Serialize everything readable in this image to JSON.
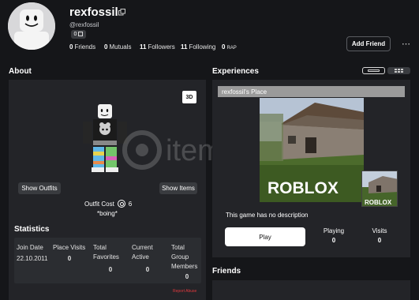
{
  "profile": {
    "username": "rexfossil",
    "handle": "@rexfossil",
    "robux_count": "0",
    "stats": [
      {
        "value": "0",
        "label": "Friends"
      },
      {
        "value": "0",
        "label": "Mutuals"
      },
      {
        "value": "11",
        "label": "Followers"
      },
      {
        "value": "11",
        "label": "Following"
      },
      {
        "value": "0",
        "label": "RAP"
      }
    ],
    "add_friend_label": "Add Friend",
    "more_icon": "⋯"
  },
  "about": {
    "heading": "About",
    "view_3d_label": "3D",
    "show_outfits_label": "Show Outfits",
    "show_items_label": "Show Items",
    "outfit_cost_label": "Outfit Cost",
    "outfit_cost_value": "6",
    "outfit_name": "*boing*"
  },
  "statistics": {
    "heading": "Statistics",
    "columns": [
      {
        "label": "Join Date",
        "value": "22.10.2011"
      },
      {
        "label": "Place Visits",
        "value": "0"
      },
      {
        "label": "Total Favorites",
        "value": "0"
      },
      {
        "label": "Current Active",
        "value": "0"
      },
      {
        "label": "Total Group Members",
        "value": "0"
      }
    ],
    "report_abuse_label": "Report Abuse"
  },
  "experiences": {
    "heading": "Experiences",
    "place_title": "rexfossil's Place",
    "thumbnail_logo": "ROBLOX",
    "description": "This game has no description",
    "play_label": "Play",
    "playing_label": "Playing",
    "playing_value": "0",
    "visits_label": "Visits",
    "visits_value": "0"
  },
  "friends": {
    "heading": "Friends"
  },
  "watermark": "itemsatis",
  "colors": {
    "background": "#151619",
    "panel": "#232428",
    "report": "#e0393e"
  }
}
